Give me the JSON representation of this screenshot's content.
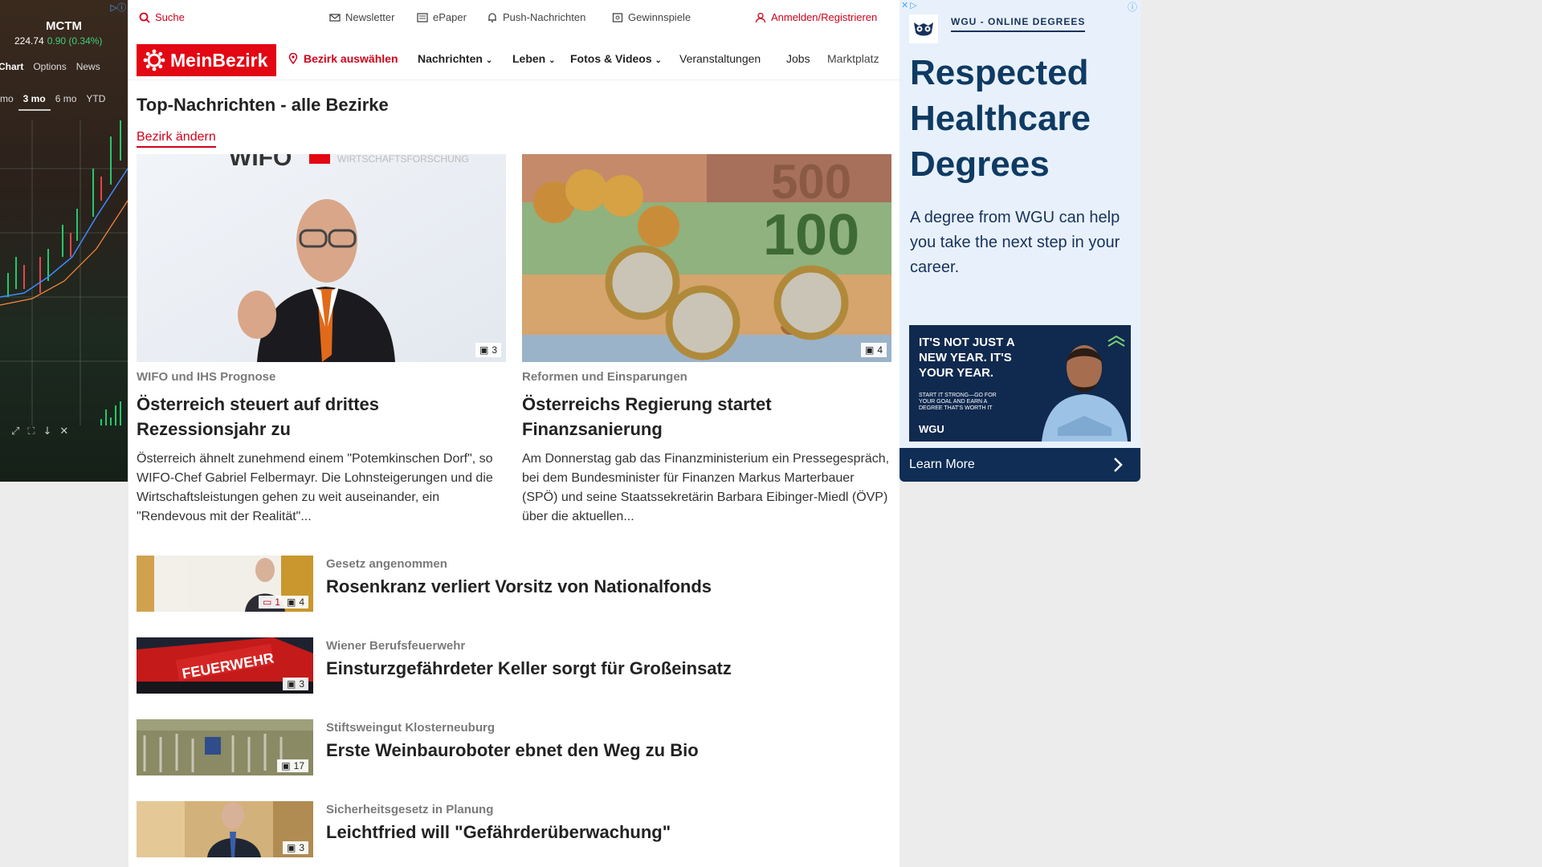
{
  "left_ad": {
    "ticker": "MCTM",
    "price": "224.74",
    "change": "0.90 (0.34%)",
    "tabs": [
      "Chart",
      "Options",
      "News"
    ],
    "ranges": [
      "mo",
      "3 mo",
      "6 mo",
      "YTD"
    ],
    "active_range": "3 mo"
  },
  "utility": {
    "search": "Suche",
    "newsletter": "Newsletter",
    "epaper": "ePaper",
    "push": "Push-Nachrichten",
    "gewinnspiele": "Gewinnspiele",
    "login": "Anmelden/Registrieren"
  },
  "nav": {
    "logo": "MeinBezirk",
    "bezirk": "Bezirk auswählen",
    "items": [
      "Nachrichten",
      "Leben",
      "Fotos & Videos",
      "Veranstaltungen",
      "Jobs",
      "Marktplatz"
    ]
  },
  "section": {
    "title": "Top-Nachrichten - alle Bezirke",
    "change_link": "Bezirk ändern"
  },
  "features": [
    {
      "kicker": "WIFO und IHS Prognose",
      "headline": "Österreich steuert auf drittes Rezessionsjahr zu",
      "teaser": "Österreich ähnelt zunehmend einem \"Potemkinschen Dorf\", so WIFO-Chef Gabriel Felbermayr. Die Lohnsteigerungen und die Wirtschaftsleistungen gehen zu weit auseinander, ein \"Rendevous mit der Realität\"...",
      "photos": "3",
      "image_text": "WIFO"
    },
    {
      "kicker": "Reformen und Einsparungen",
      "headline": "Österreichs Regierung startet Finanzsanierung",
      "teaser": "Am Donnerstag gab das Finanzministerium ein Pressegespräch, bei dem Bundesminister für Finanzen Markus Marterbauer (SPÖ) und seine Staatssekretärin Barbara Eibinger-Miedl (ÖVP) über die aktuellen...",
      "photos": "4",
      "image_text": "100"
    }
  ],
  "articles": [
    {
      "kicker": "Gesetz angenommen",
      "headline": "Rosenkranz verliert Vorsitz von Nationalfonds",
      "comments": "1",
      "photos": "4"
    },
    {
      "kicker": "Wiener Berufsfeuerwehr",
      "headline": "Einsturzgefährdeter Keller sorgt für Großeinsatz",
      "photos": "3",
      "image_text": "FEUERWEHR"
    },
    {
      "kicker": "Stiftsweingut Klosterneuburg",
      "headline": "Erste Weinbauroboter ebnet den Weg zu Bio",
      "photos": "17"
    },
    {
      "kicker": "Sicherheitsgesetz in Planung",
      "headline": "Leichtfried will \"Gefährderüberwachung\"",
      "photos": "3"
    }
  ],
  "right_ad": {
    "brand": "WGU - ONLINE DEGREES",
    "headline": "Respected Healthcare Degrees",
    "body": "A degree from WGU can help you take the next step in your career.",
    "banner_title": "IT'S NOT JUST A NEW YEAR. IT'S YOUR YEAR.",
    "banner_small": "START IT STRONG—GO FOR YOUR GOAL AND EARN A DEGREE THAT'S WORTH IT",
    "banner_logo": "WGU",
    "cta": "Learn More"
  },
  "colors": {
    "brand_red": "#e30613",
    "link_red": "#d0021b",
    "ad_navy": "#0f3a63"
  }
}
